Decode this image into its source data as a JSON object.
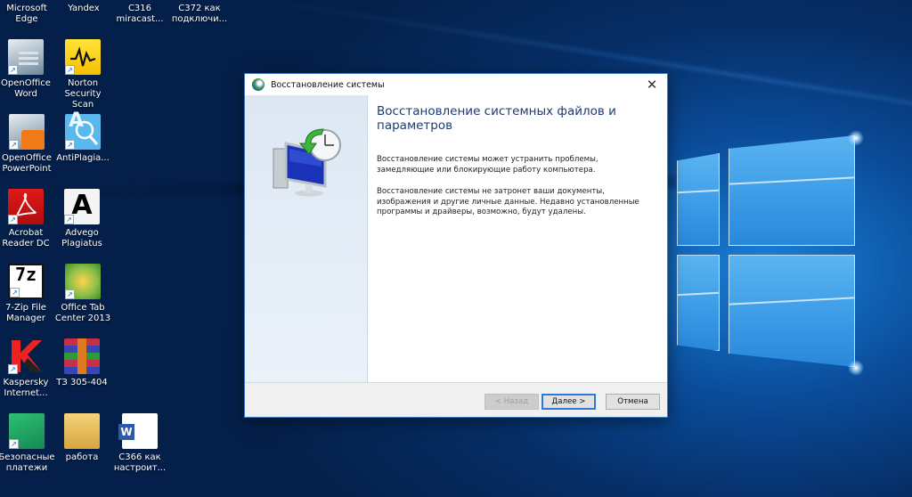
{
  "desktop": {
    "icons": [
      {
        "label": "Microsoft Edge",
        "icon": "edge-icon"
      },
      {
        "label": "Yandex",
        "icon": "yandex-icon"
      },
      {
        "label": "С316 miracast...",
        "icon": "document-icon"
      },
      {
        "label": "С372 как подключи...",
        "icon": "document-icon"
      },
      {
        "label": "OpenOffice Word",
        "icon": "openoffice-writer-icon"
      },
      {
        "label": "Norton Security Scan",
        "icon": "norton-icon"
      },
      {
        "label": "OpenOffice PowerPoint",
        "icon": "openoffice-impress-icon"
      },
      {
        "label": "AntiPlagia...",
        "icon": "antiplagiat-icon"
      },
      {
        "label": "Acrobat Reader DC",
        "icon": "acrobat-icon"
      },
      {
        "label": "Advego Plagiatus",
        "icon": "advego-icon"
      },
      {
        "label": "7-Zip File Manager",
        "icon": "7zip-icon"
      },
      {
        "label": "Office Tab Center 2013",
        "icon": "office-tab-icon"
      },
      {
        "label": "Kaspersky Internet...",
        "icon": "kaspersky-icon"
      },
      {
        "label": "ТЗ 305-404",
        "icon": "winrar-archive-icon"
      },
      {
        "label": "Безопасные платежи",
        "icon": "safe-money-icon"
      },
      {
        "label": "работа",
        "icon": "folder-icon"
      },
      {
        "label": "С366 как настроит...",
        "icon": "word-document-icon"
      }
    ],
    "glyphs": {
      "norton": "〰",
      "antiplag": "A",
      "advego": "A",
      "sevenzip": "7z",
      "kaspersky": "K",
      "shortcut": "↗",
      "close": "✕"
    }
  },
  "dialog": {
    "title": "Восстановление системы",
    "heading": "Восстановление системных файлов и параметров",
    "paragraphs": [
      "Восстановление системы может устранить проблемы, замедляющие или блокирующие работу компьютера.",
      "Восстановление системы не затронет ваши документы, изображения и другие личные данные. Недавно установленные программы и драйверы, возможно, будут удалены."
    ],
    "buttons": {
      "back": "< Назад",
      "next": "Далее >",
      "cancel": "Отмена"
    },
    "colors": {
      "accent": "#2a7bd1",
      "heading": "#1e3a6e",
      "sidepanel": "#dde8f4"
    }
  }
}
